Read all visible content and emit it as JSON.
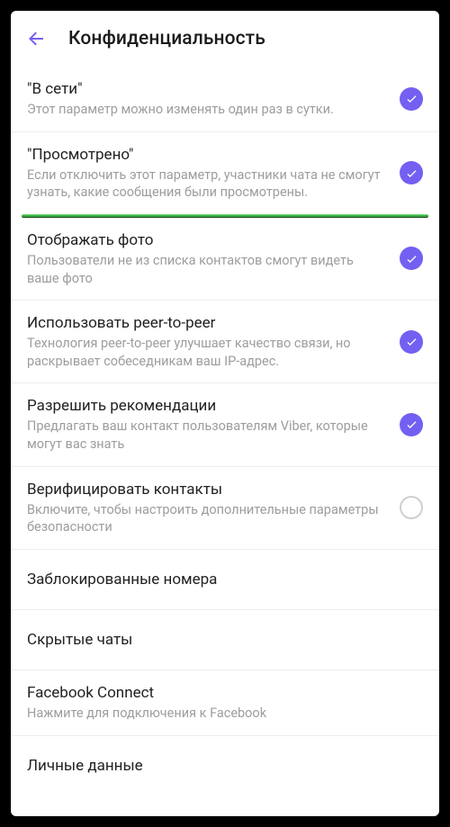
{
  "header": {
    "title": "Конфиденциальность"
  },
  "items": {
    "online": {
      "title": "\"В сети\"",
      "sub": "Этот параметр можно изменять один раз в сутки.",
      "checked": true
    },
    "seen": {
      "title": "\"Просмотрено\"",
      "sub": "Если отключить этот параметр, участники чата не смогут узнать, какие сообщения были просмотрены.",
      "checked": true
    },
    "photo": {
      "title": "Отображать фото",
      "sub": "Пользователи не из списка контактов смогут видеть ваше фото",
      "checked": true
    },
    "p2p": {
      "title": "Использовать peer-to-peer",
      "sub": "Технология peer-to-peer улучшает качество связи, но раскрывает собеседникам ваш IP-адрес.",
      "checked": true
    },
    "recommend": {
      "title": "Разрешить рекомендации",
      "sub": "Предлагать ваш контакт пользователям Viber, которые могут вас знать",
      "checked": true
    },
    "verify": {
      "title": "Верифицировать контакты",
      "sub": "Включите, чтобы настроить дополнительные параметры безопасности",
      "checked": false
    },
    "blocked": {
      "title": "Заблокированные номера"
    },
    "hidden": {
      "title": "Скрытые чаты"
    },
    "facebook": {
      "title": "Facebook Connect",
      "sub": "Нажмите для подключения к Facebook"
    },
    "personal": {
      "title": "Личные данные"
    }
  }
}
